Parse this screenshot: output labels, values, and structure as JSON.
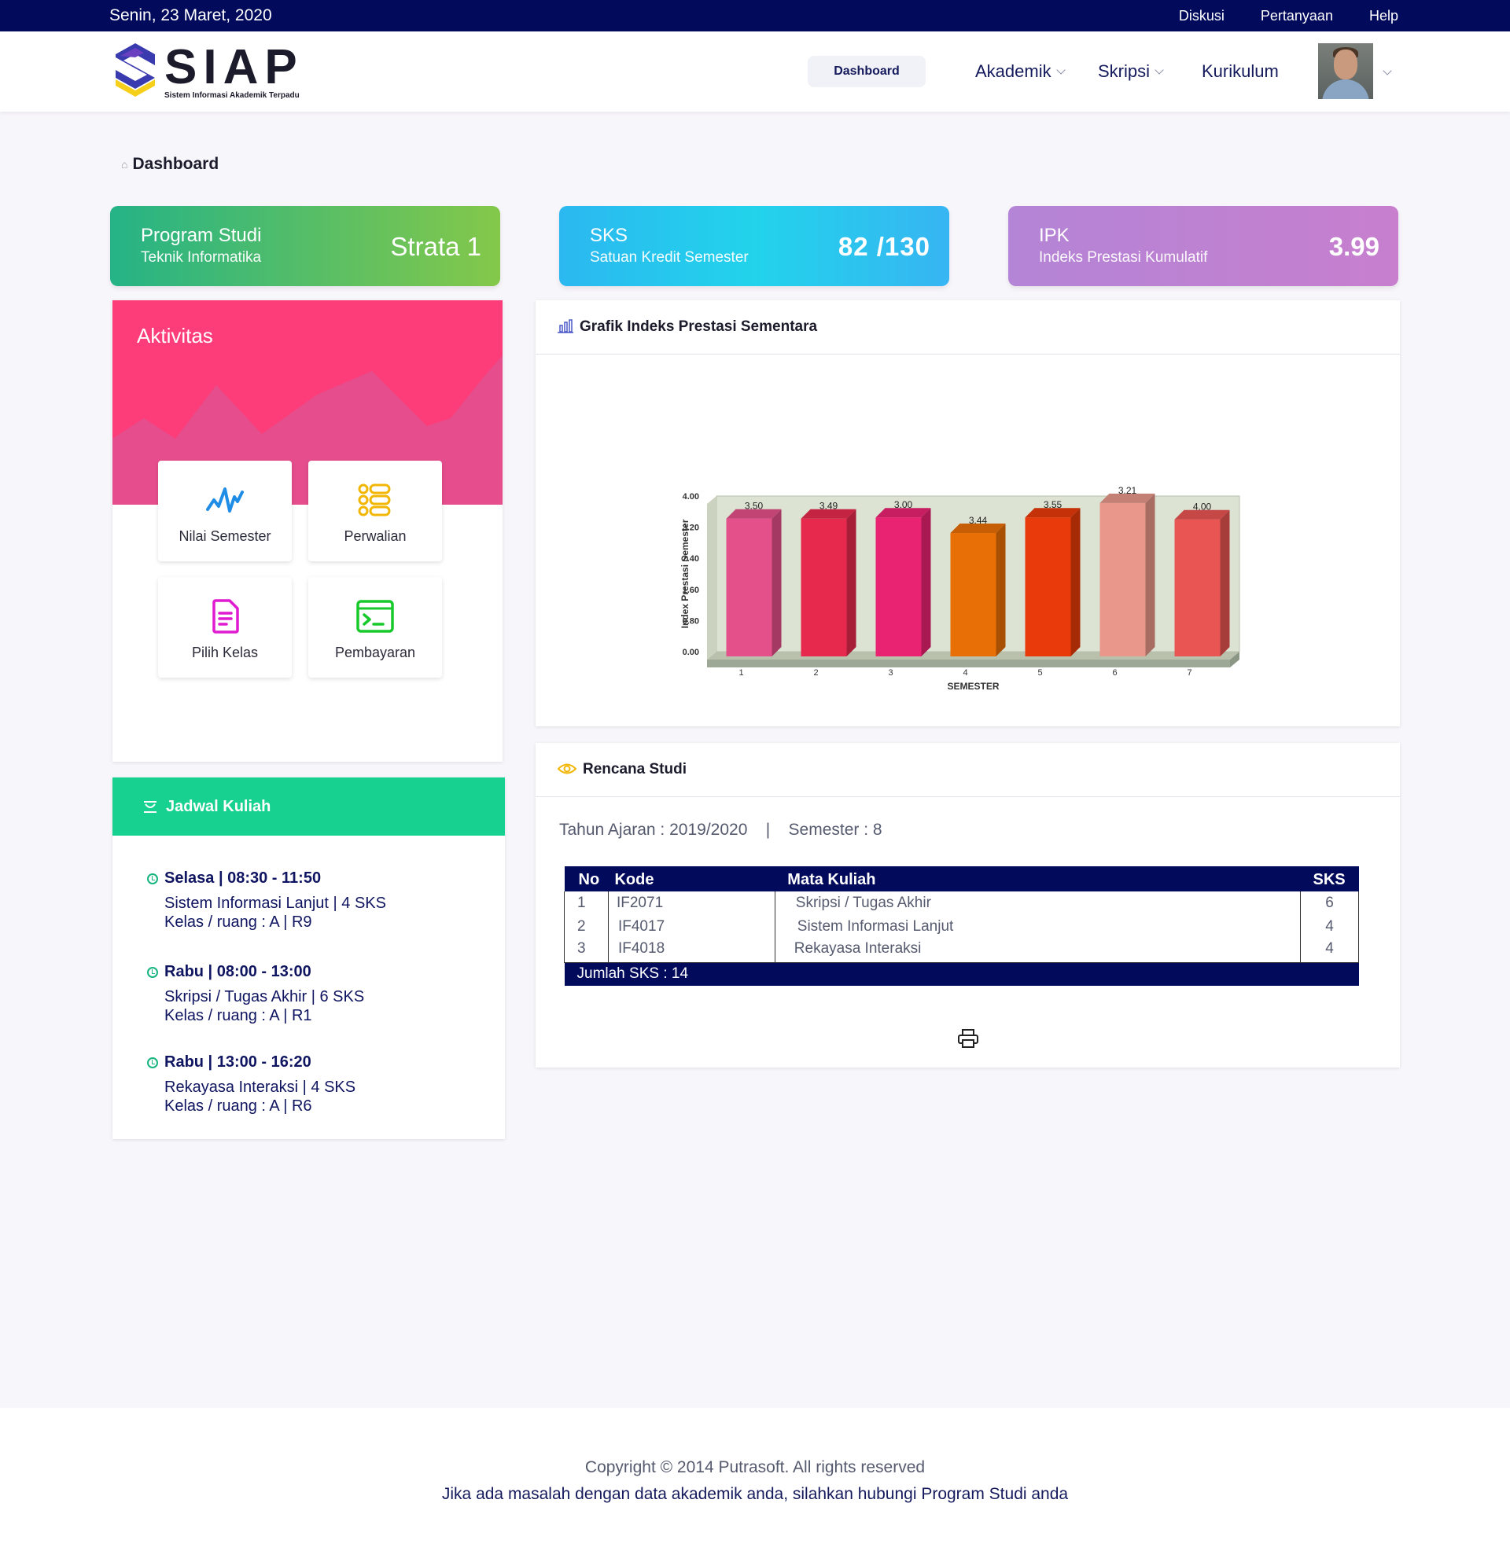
{
  "topbar": {
    "date": "Senin, 23 Maret, 2020",
    "links": [
      "Diskusi",
      "Pertanyaan",
      "Help"
    ]
  },
  "logo": {
    "word": "SIAP",
    "tagline": "Sistem Informasi Akademik Terpadu"
  },
  "nav": {
    "dashboard": "Dashboard",
    "akademik": "Akademik",
    "skripsi": "Skripsi",
    "kurikulum": "Kurikulum"
  },
  "breadcrumb": {
    "label": "Dashboard"
  },
  "stats": {
    "program": {
      "title": "Program Studi",
      "subtitle": "Teknik Informatika",
      "value": "Strata 1"
    },
    "sks": {
      "title": "SKS",
      "subtitle": "Satuan Kredit Semester",
      "value": "82 /130"
    },
    "ipk": {
      "title": "IPK",
      "subtitle": "Indeks Prestasi Kumulatif",
      "value": "3.99"
    }
  },
  "aktivitas": {
    "title": "Aktivitas",
    "tiles": [
      "Nilai Semester",
      "Perwalian",
      "Pilih Kelas",
      "Pembayaran"
    ]
  },
  "jadwal": {
    "title": "Jadwal Kuliah",
    "items": [
      {
        "when": "Selasa | 08:30 - 11:50",
        "course": "Sistem Informasi Lanjut | 4 SKS",
        "room": "Kelas / ruang : A | R9"
      },
      {
        "when": "Rabu | 08:00 - 13:00",
        "course": "Skripsi / Tugas Akhir | 6 SKS",
        "room": "Kelas / ruang : A | R1"
      },
      {
        "when": "Rabu | 13:00 - 16:20",
        "course": "Rekayasa Interaksi | 4 SKS",
        "room": "Kelas / ruang : A | R6"
      }
    ]
  },
  "grafik": {
    "title": "Grafik Indeks Prestasi Sementara"
  },
  "chart_data": {
    "type": "bar",
    "categories": [
      "1",
      "2",
      "3",
      "4",
      "5",
      "6",
      "7"
    ],
    "values": [
      3.5,
      3.49,
      3.0,
      3.44,
      3.55,
      3.21,
      4.0
    ],
    "heights": [
      3.42,
      3.42,
      3.45,
      3.05,
      3.45,
      3.82,
      3.4
    ],
    "data_labels": [
      "3.50",
      "3.49",
      "3.00",
      "3.44",
      "3.55",
      "3.21",
      "4.00"
    ],
    "colors": [
      "#e4508a",
      "#e8294e",
      "#e92372",
      "#e86f06",
      "#e83a0a",
      "#e8978a",
      "#e85552"
    ],
    "ylim": [
      0,
      4
    ],
    "yticks": [
      "0.00",
      "0.80",
      "1.60",
      "2.40",
      "3.20",
      "4.00"
    ],
    "xlabel": "SEMESTER",
    "ylabel": "Index Prestasi Semester",
    "grid": false
  },
  "rencana": {
    "title": "Rencana Studi",
    "tahun": "Tahun Ajaran : 2019/2020",
    "sep": "|",
    "semester": "Semester : 8",
    "headers": [
      "No",
      "Kode",
      "Mata Kuliah",
      "SKS"
    ],
    "rows": [
      [
        "1",
        "IF2071",
        "Skripsi / Tugas Akhir",
        "6"
      ],
      [
        "2",
        "IF4017",
        "Sistem Informasi Lanjut",
        "4"
      ],
      [
        "3",
        "IF4018",
        "Rekayasa Interaksi",
        "4"
      ]
    ],
    "total": "Jumlah SKS : 14"
  },
  "footer": {
    "copyright": "Copyright © 2014 Putrasoft. All rights reserved",
    "note": "Jika ada masalah dengan data akademik anda, silahkan hubungi Program Studi anda"
  }
}
